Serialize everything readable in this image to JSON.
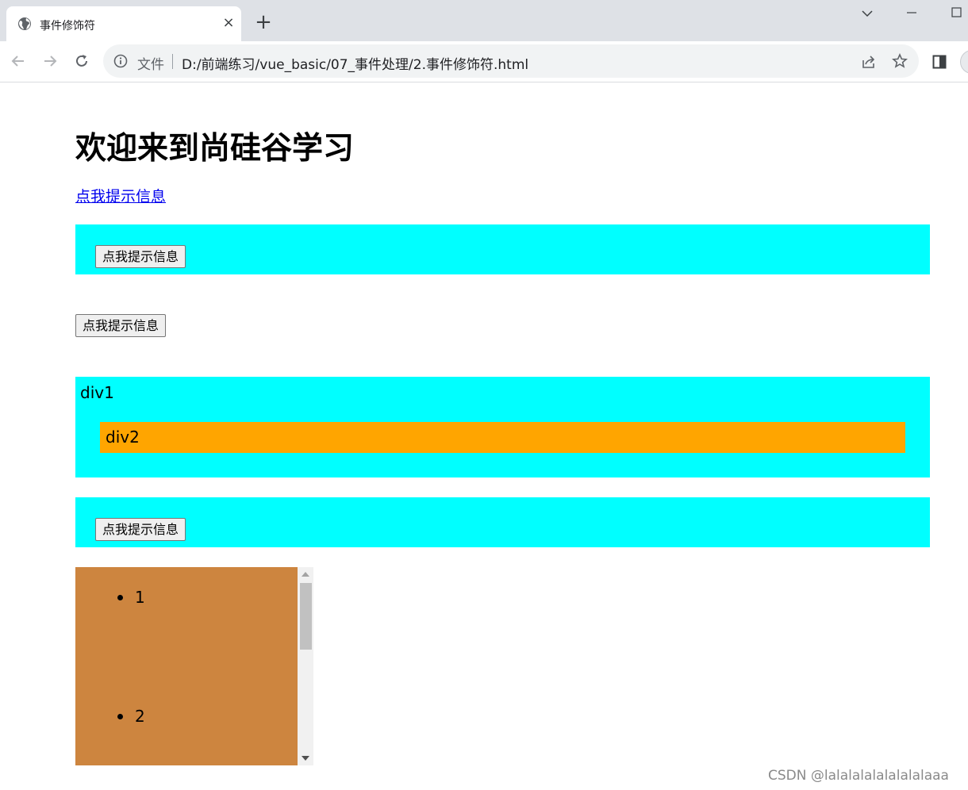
{
  "browser": {
    "tab": {
      "title": "事件修饰符",
      "favicon": "globe-icon",
      "close": "×"
    },
    "new_tab": "+",
    "address_bar": {
      "security_label": "文件",
      "url": "D:/前端练习/vue_basic/07_事件处理/2.事件修饰符.html"
    },
    "icons": [
      "back-icon",
      "forward-icon",
      "reload-icon",
      "info-icon",
      "share-icon",
      "star-icon",
      "side-panel-icon",
      "minimize-icon",
      "maximize-icon",
      "tab-search-icon"
    ]
  },
  "page": {
    "title": "欢迎来到尚硅谷学习",
    "link_text": "点我提示信息",
    "button1_label": "点我提示信息",
    "button2_label": "点我提示信息",
    "div1_label": "div1",
    "div2_label": "div2",
    "button3_label": "点我提示信息",
    "list": {
      "items": [
        "1",
        "2"
      ]
    }
  },
  "colors": {
    "cyan_panel": "#00ffff",
    "orange_panel": "#ffa500",
    "list_background": "#cd853f",
    "link": "#0000ee"
  },
  "watermark": "CSDN @lalalalalalalalalaaa"
}
